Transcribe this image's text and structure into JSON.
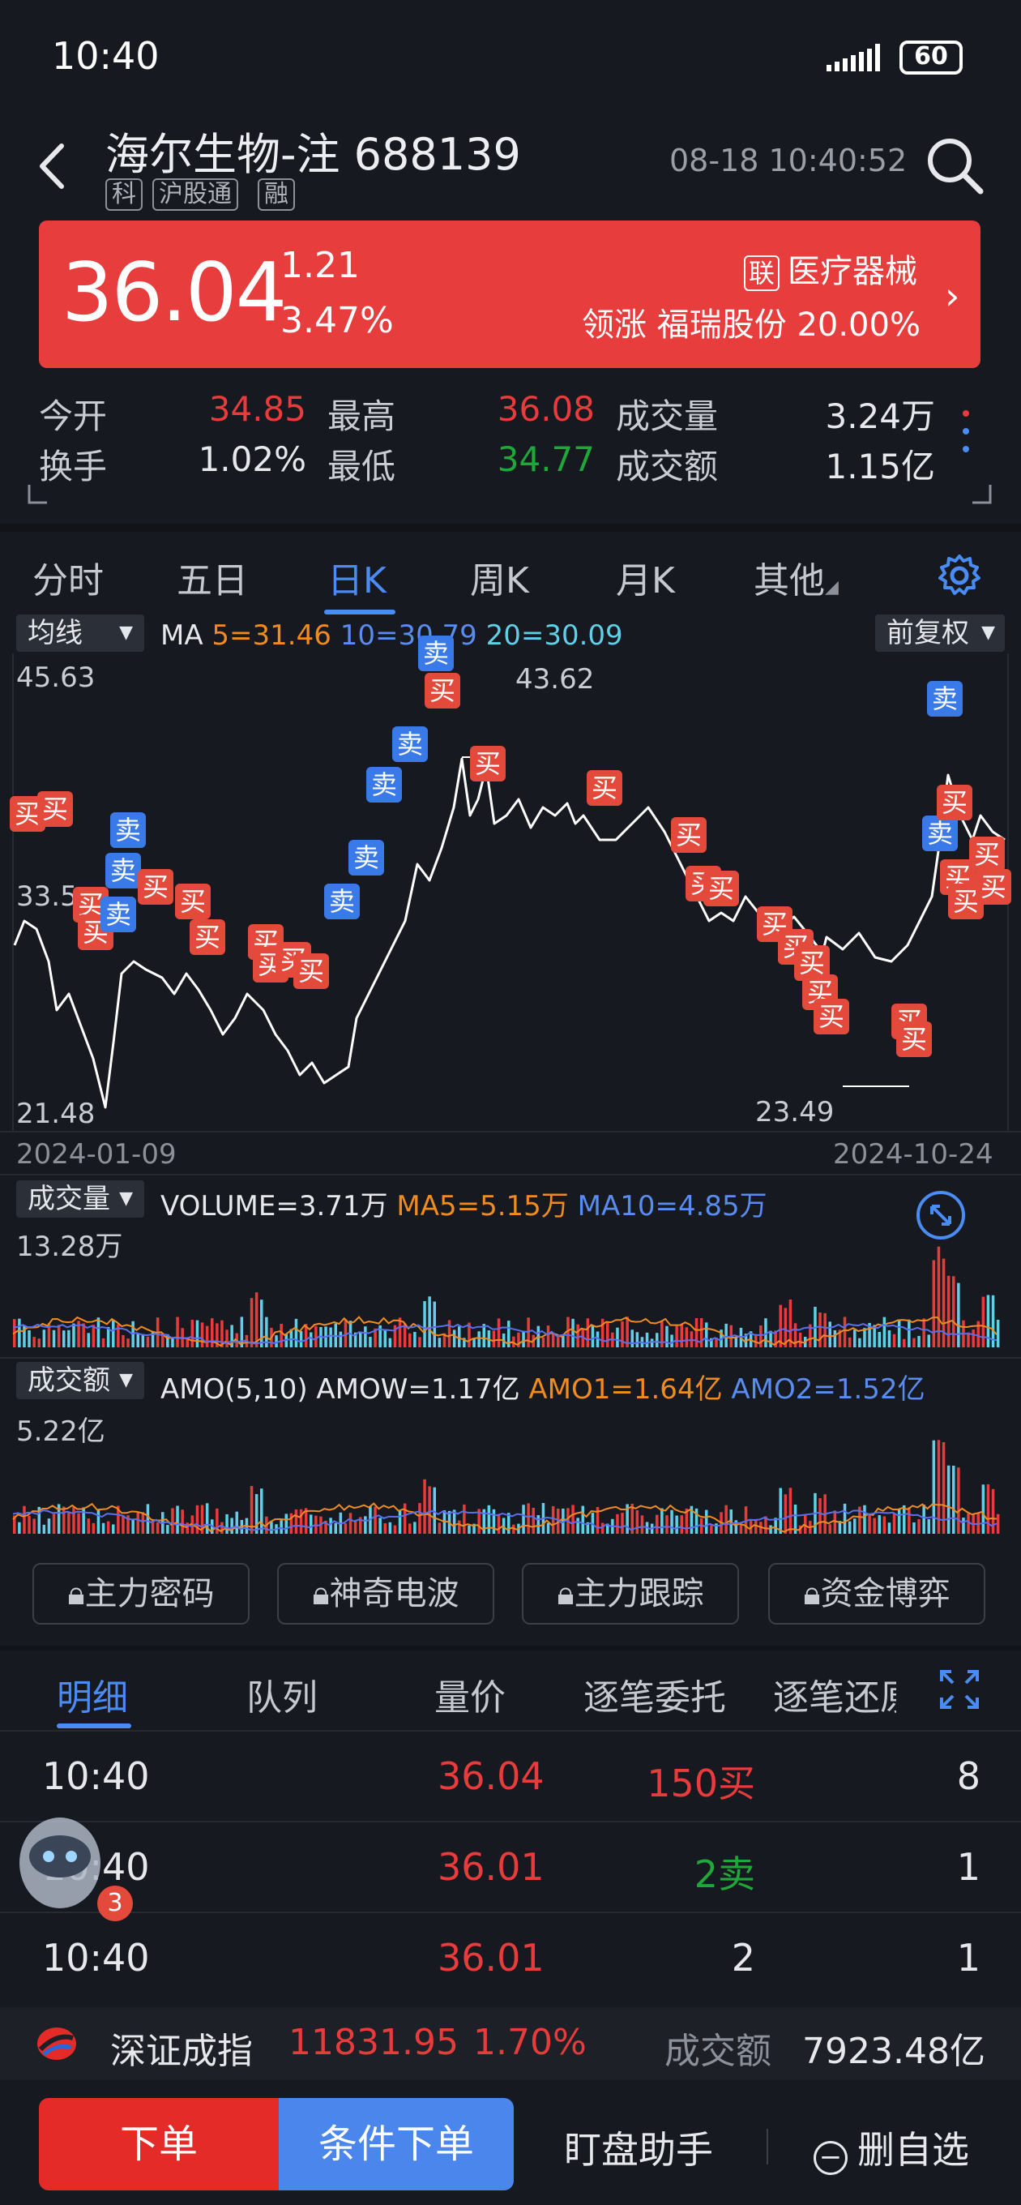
{
  "status_bar": {
    "time": "10:40",
    "battery": "60"
  },
  "header": {
    "stock_name": "海尔生物-注",
    "stock_code": "688139",
    "tags": [
      "科",
      "沪股通",
      "融"
    ],
    "datetime": "08-18 10:40:52"
  },
  "banner": {
    "price": "36.04",
    "change": "1.21",
    "change_pct": "3.47%",
    "industry_badge": "联",
    "industry": "医疗器械",
    "leader_label": "领涨",
    "leader_name": "福瑞股份",
    "leader_pct": "20.00%",
    "bg_color": "#e83d3d"
  },
  "quote": {
    "open_label": "今开",
    "open": "34.85",
    "high_label": "最高",
    "high": "36.08",
    "volume_label": "成交量",
    "volume": "3.24万",
    "turnover_label": "换手",
    "turnover": "1.02%",
    "low_label": "最低",
    "low": "34.77",
    "amount_label": "成交额",
    "amount": "1.15亿"
  },
  "period_tabs": [
    "分时",
    "五日",
    "日K",
    "周K",
    "月K",
    "其他"
  ],
  "active_period": "日K",
  "kline": {
    "indicator_dropdown": "均线",
    "ma_label": "MA",
    "ma5": "5=31.46",
    "ma10": "10=30.79",
    "ma20": "20=30.09",
    "adjust_dropdown": "前复权",
    "y_top": "45.63",
    "y_mid": "33.5",
    "y_bottom": "21.48",
    "high_marker": "43.62",
    "low_marker": "23.49",
    "date_start": "2024-01-09",
    "date_end": "2024-10-24",
    "buy_label": "买",
    "sell_label": "卖"
  },
  "volume_panel": {
    "dropdown": "成交量",
    "volume": "VOLUME=3.71万",
    "ma5": "MA5=5.15万",
    "ma10": "MA10=4.85万",
    "max": "13.28万"
  },
  "amount_panel": {
    "dropdown": "成交额",
    "amo": "AMO(5,10)",
    "amow": "AMOW=1.17亿",
    "amo1": "AMO1=1.64亿",
    "amo2": "AMO2=1.52亿",
    "max": "5.22亿"
  },
  "indicator_buttons": [
    "主力密码",
    "神奇电波",
    "主力跟踪",
    "资金博弈"
  ],
  "detail_tabs": [
    "明细",
    "队列",
    "量价",
    "逐笔委托",
    "逐笔还原"
  ],
  "active_detail": "明细",
  "trades": [
    {
      "time": "10:40",
      "price": "36.04",
      "vol": "150买",
      "side": "buy",
      "count": "8"
    },
    {
      "time": "10:40",
      "price": "36.01",
      "vol": "2卖",
      "side": "sell",
      "count": "1"
    },
    {
      "time": "10:40",
      "price": "36.01",
      "vol": "2",
      "side": "none",
      "count": "1"
    }
  ],
  "assistant_badge": "3",
  "index_bar": {
    "name": "深证成指",
    "value": "11831.95",
    "pct": "1.70%",
    "amount_label": "成交额",
    "amount": "7923.48亿"
  },
  "actions": {
    "order": "下单",
    "conditional_order": "条件下单",
    "assistant": "盯盘助手",
    "remove_watch": "删自选"
  }
}
